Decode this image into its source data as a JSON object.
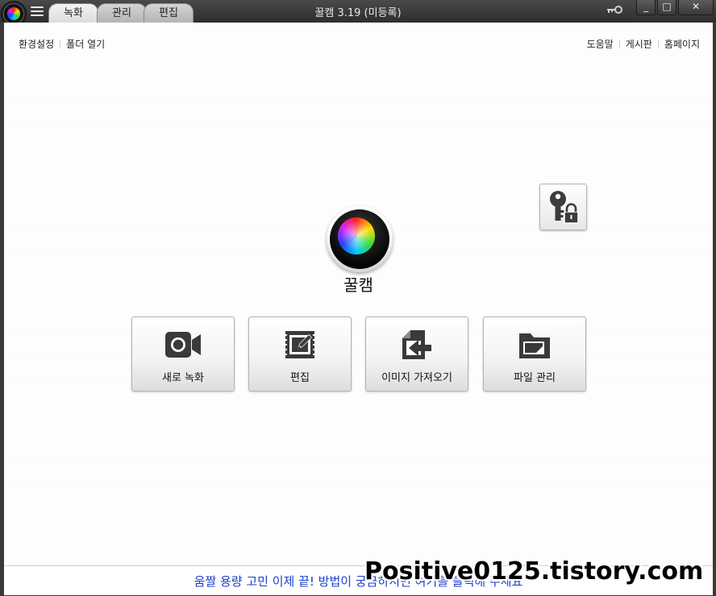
{
  "window": {
    "title": "꿀캠 3.19 (미등록)",
    "tabs": [
      {
        "label": "녹화"
      },
      {
        "label": "관리"
      },
      {
        "label": "편집"
      }
    ],
    "controls": {
      "minimize": "_",
      "maximize": "□",
      "close": "✕"
    }
  },
  "toolbar": {
    "left_links": [
      {
        "label": "환경설정"
      },
      {
        "label": "폴더 열기"
      }
    ],
    "right_links": [
      {
        "label": "도움말"
      },
      {
        "label": "게시판"
      },
      {
        "label": "홈페이지"
      }
    ]
  },
  "center": {
    "app_name": "꿀캠"
  },
  "actions": [
    {
      "label": "새로 녹화",
      "icon": "video-camera-icon"
    },
    {
      "label": "편집",
      "icon": "edit-icon"
    },
    {
      "label": "이미지 가져오기",
      "icon": "import-image-icon"
    },
    {
      "label": "파일 관리",
      "icon": "folder-icon"
    }
  ],
  "bottom": {
    "ad_text": "움짤 용량 고민 이제 끝! 방법이 궁금하시면 여기를 클릭해 주세요",
    "watermark": "Positive0125.tistory.com"
  },
  "colors": {
    "ad_link": "#1a3ec8",
    "frame": "#3a3a3a"
  }
}
